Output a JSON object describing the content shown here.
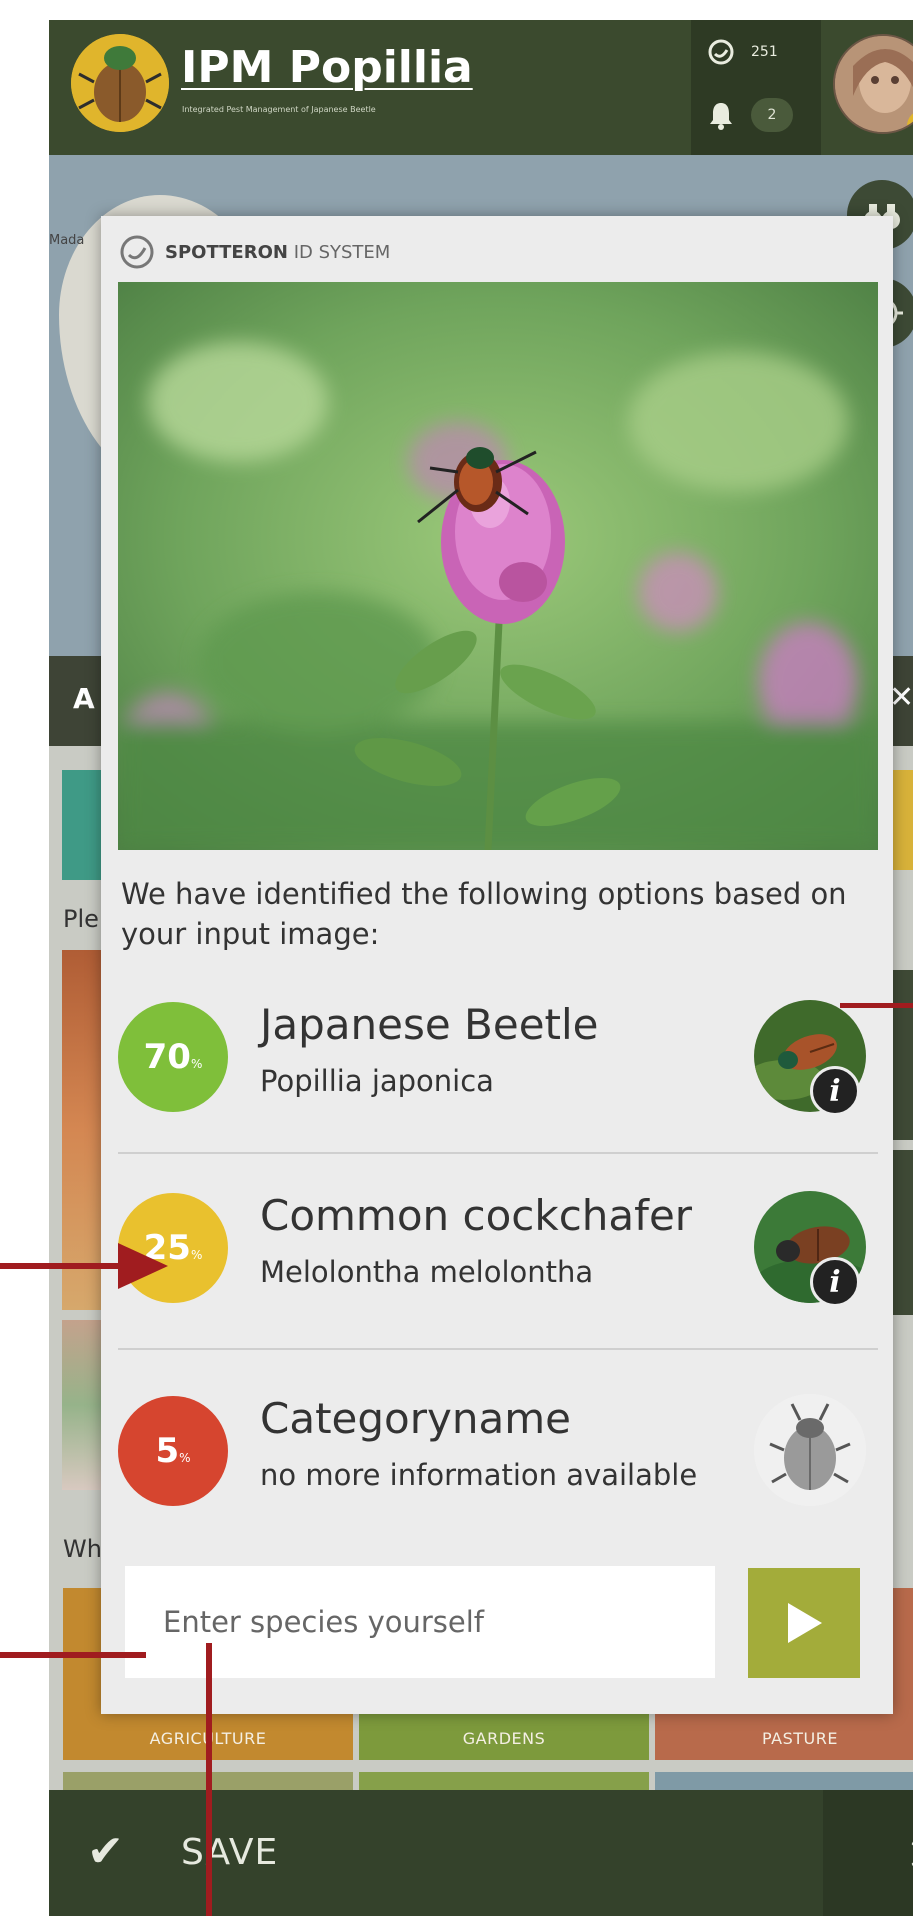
{
  "app": {
    "title": "IPM Popillia",
    "subtitle": "Integrated Pest Management of Japanese Beetle",
    "spots_count": "251",
    "notifications_count": "2"
  },
  "map": {
    "label": "Mada"
  },
  "form": {
    "header_letter": "A",
    "close_glyph": "✕",
    "prompt_fragment_1": "Ple",
    "prompt_fragment_2": "Wh",
    "categories": [
      "AGRICULTURE",
      "GARDENS",
      "PASTURE"
    ]
  },
  "save_bar": {
    "label": "SAVE"
  },
  "modal": {
    "brand": "SPOTTERON",
    "system": "ID SYSTEM",
    "intro": "We have identified the following options based on your input image:",
    "options": [
      {
        "percent": "70",
        "name": "Japanese Beetle",
        "latin": "Popillia japonica",
        "color": "#7fbf3a"
      },
      {
        "percent": "25",
        "name": "Common cockchafer",
        "latin": "Melolontha melolontha",
        "color": "#e9c12e"
      },
      {
        "percent": "5",
        "name": "Categoryname",
        "latin": "no more information available",
        "color": "#d6452f"
      }
    ],
    "percent_sign": "%",
    "info_glyph": "i",
    "input_placeholder": "Enter species yourself"
  },
  "colors": {
    "topbar": "#3b4a2e",
    "save_bar": "#34422b",
    "submit_button": "#a3ac3a",
    "annotation_arrow": "#a01c1f"
  },
  "icons": {
    "logo": "beetle-logo-icon",
    "spots": "spot-icon",
    "notifications": "bell-icon",
    "save": "check-icon",
    "submit": "play-icon",
    "info": "info-icon",
    "side_buttons": [
      "binoculars-icon",
      "locate-icon"
    ],
    "hourglass": "hourglass-icon"
  }
}
